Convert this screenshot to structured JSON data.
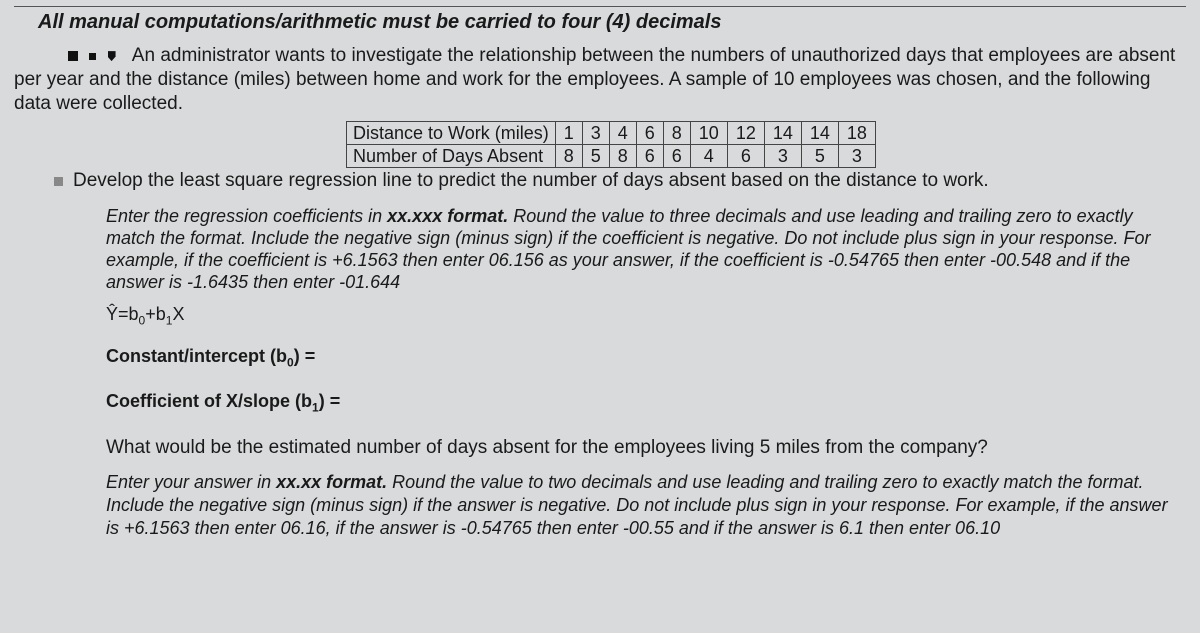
{
  "title": "All manual computations/arithmetic must be carried to four (4) decimals",
  "problem_intro_lead": "An administrator wants to investigate the relationship between the numbers of unauthorized days that employees are",
  "problem_intro_rest": "absent per year and the distance (miles) between home and work for the employees.  A sample of 10 employees was chosen, and the following data were collected.",
  "table": {
    "row1_label": "Distance to Work (miles)",
    "row2_label": "Number of Days Absent",
    "distance": [
      "1",
      "3",
      "4",
      "6",
      "8",
      "10",
      "12",
      "14",
      "14",
      "18"
    ],
    "absent": [
      "8",
      "5",
      "8",
      "6",
      "6",
      "4",
      "6",
      "3",
      "5",
      "3"
    ]
  },
  "task": "Develop the least square regression line to predict the number of days absent based on the distance to work.",
  "instr1_a": "Enter the regression coefficients in ",
  "instr1_fmt": "xx.xxx format.",
  "instr1_b": "  Round the value to three decimals and use leading and trailing zero to exactly match the format.  Include the negative sign (minus sign) if the coefficient is negative. Do not include plus sign in your response.  For example, if the coefficient is +6.1563 then enter 06.156 as your answer, if the coefficient is -0.54765 then enter -00.548 and if the answer is -1.6435 then enter -01.644",
  "eqn_text": {
    "yhat": "Ŷ=b",
    "z0": "0",
    "plus": "+b",
    "z1": "1",
    "x": "X"
  },
  "field1_label_a": "Constant/intercept (b",
  "field1_label_sub": "0",
  "field1_label_b": ") =",
  "field2_label_a": "Coefficient of X/slope (b",
  "field2_label_sub": "1",
  "field2_label_b": ") =",
  "question": "What would be the estimated number of days absent for the employees living 5 miles from the company?",
  "instr2_a": "Enter your answer in ",
  "instr2_fmt": "xx.xx format.",
  "instr2_b": "  Round the value to two decimals and use leading and trailing zero to exactly match the format.  Include the negative sign (minus sign) if the answer is negative. Do not include plus sign in your response.  For example, if the answer is +6.1563 then enter 06.16, if the answer is -0.54765 then enter -00.55 and if the answer is 6.1 then enter 06.10"
}
